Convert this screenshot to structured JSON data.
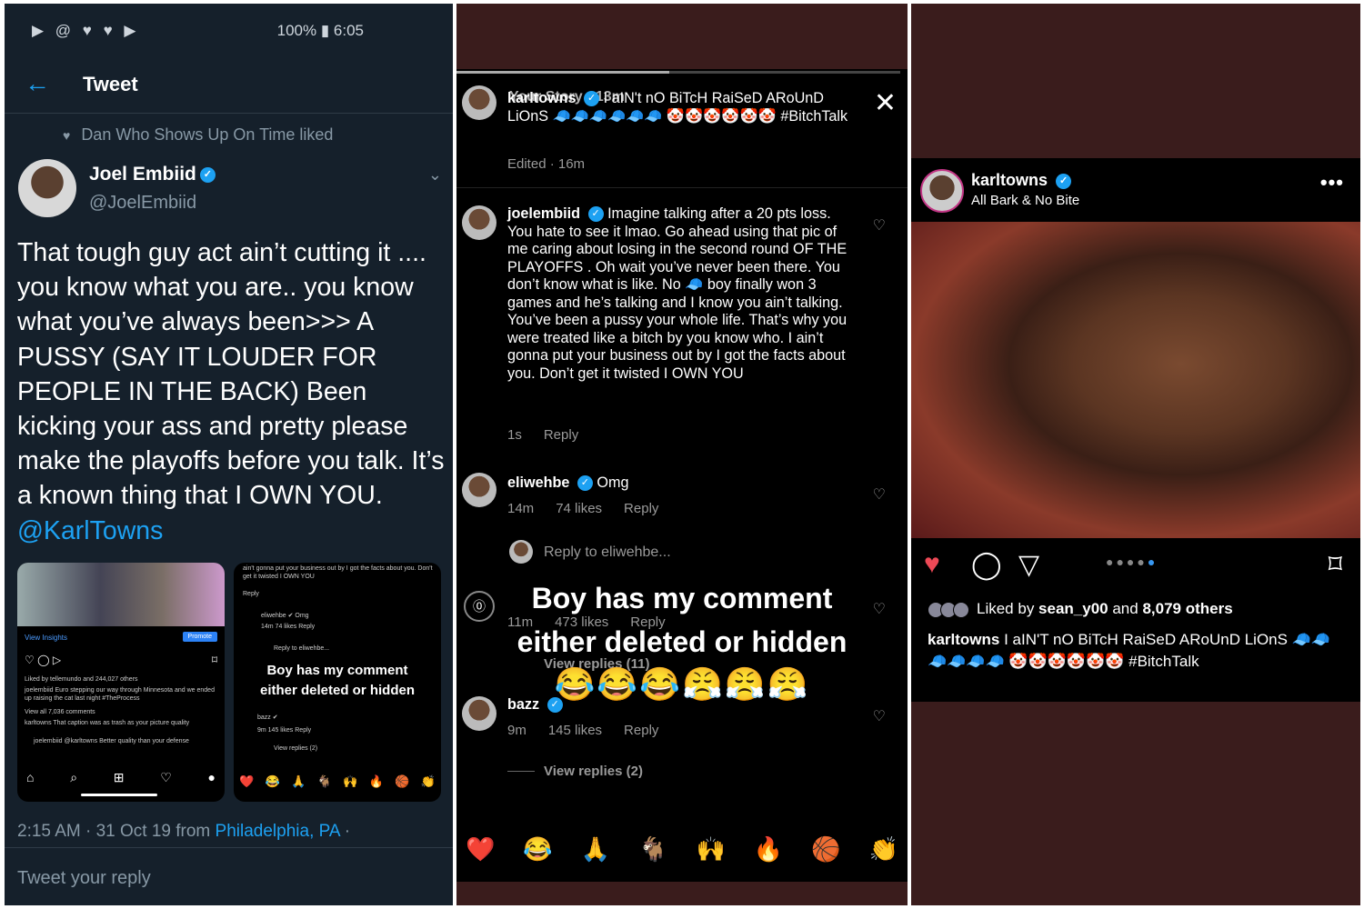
{
  "twitter": {
    "status_left": "▶ @ ♥ ♥ ▶",
    "status_right": "100% ▮ 6:05",
    "header_title": "Tweet",
    "liked_by": "Dan Who Shows Up On Time liked",
    "author_name": "Joel Embiid",
    "author_handle": "@JoelEmbiid",
    "tweet_text": "That tough guy act ain’t cutting it .... you know what you are.. you know what you’ve always been>>> A PUSSY  (SAY IT LOUDER FOR PEOPLE IN THE BACK) Been kicking your ass and pretty please make the playoffs before you talk. It’s a known thing that I OWN YOU.",
    "tweet_mention": "@KarlTowns",
    "meta_time": "2:15 AM · 31 Oct 19 from ",
    "meta_place": "Philadelphia, PA",
    "meta_tail": " ·",
    "reply_placeholder": "Tweet your reply",
    "thumb1": {
      "view_insights": "View Insights",
      "promote": "Promote",
      "liked": "Liked by tellemundo and 244,027 others",
      "caption": "joelembiid Euro stepping our way through Minnesota and we ended up raising the cat last night #TheProcess",
      "view_all": "View all 7,036 comments",
      "c1": "karltowns That caption was as trash as your picture quality",
      "c2": "joelembiid @karltowns Better quality than your defense"
    },
    "thumb2": {
      "top_text": "ain't gonna put your business out by I got the facts about you. Don't get it twisted I OWN YOU",
      "reply": "Reply",
      "c1": "eliwehbe ✔ Omg",
      "c1_meta": "14m   74 likes   Reply",
      "reply_to": "Reply to eliwehbe...",
      "overlay_1": "Boy has my comment",
      "overlay_2": "either deleted or hidden",
      "c2": "bazz ✔",
      "c2_meta": "9m   145 likes   Reply",
      "view_replies": "View replies (2)"
    }
  },
  "story": {
    "title": "Your Story · 13m",
    "c0_user": "karltowns",
    "c0_text": "I aIN't nO BiTcH RaiSeD ARoUnD LiOnS 🧢🧢🧢🧢🧢🧢 🤡🤡🤡🤡🤡🤡 #BitchTalk",
    "c0_meta": "Edited · 16m",
    "c1_user": "joelembiid",
    "c1_text": "Imagine talking after a 20 pts loss. You hate to see it lmao. Go ahead using that pic of me caring about losing in the second round OF THE PLAYOFFS . Oh wait you’ve never been there. You don’t know what is like. No 🧢 boy finally won 3 games and he’s talking and I know you ain’t talking. You’ve been a pussy your whole life. That’s why you were treated like a bitch by you know who. I ain’t gonna put your business out by I got the facts about you. Don’t get it twisted I OWN YOU",
    "c1_time": "1s",
    "c1_reply": "Reply",
    "c2_user": "eliwehbe",
    "c2_text": "Omg",
    "c2_time": "14m",
    "c2_likes": "74 likes",
    "c2_reply": "Reply",
    "reply_to": "Reply to eliwehbe...",
    "c3_meta_time": "11m",
    "c3_meta_likes": "473 likes",
    "c3_reply": "Reply",
    "c3_view_replies": "View replies (11)",
    "overlay_1": "Boy has my comment",
    "overlay_2": "either deleted or hidden",
    "overlay_emoji": "😂😂😂😤😤😤",
    "c4_user": "bazz",
    "c4_time": "9m",
    "c4_likes": "145 likes",
    "c4_reply": "Reply",
    "c4_view_replies": "View replies (2)",
    "reactions": [
      "❤️",
      "😂",
      "🙏",
      "🐐",
      "🙌",
      "🔥",
      "🏀",
      "👏"
    ]
  },
  "post": {
    "username": "karltowns",
    "subtitle": "All Bark & No Bite",
    "liked_prefix": "Liked by ",
    "liked_user": "sean_y00",
    "liked_and": " and ",
    "liked_count": "8,079 others",
    "caption_user": "karltowns",
    "caption_text": " I aIN'T nO BiTcH RaiSeD ARoUnD LiOnS 🧢🧢🧢🧢🧢🧢 🤡🤡🤡🤡🤡🤡 #BitchTalk"
  }
}
